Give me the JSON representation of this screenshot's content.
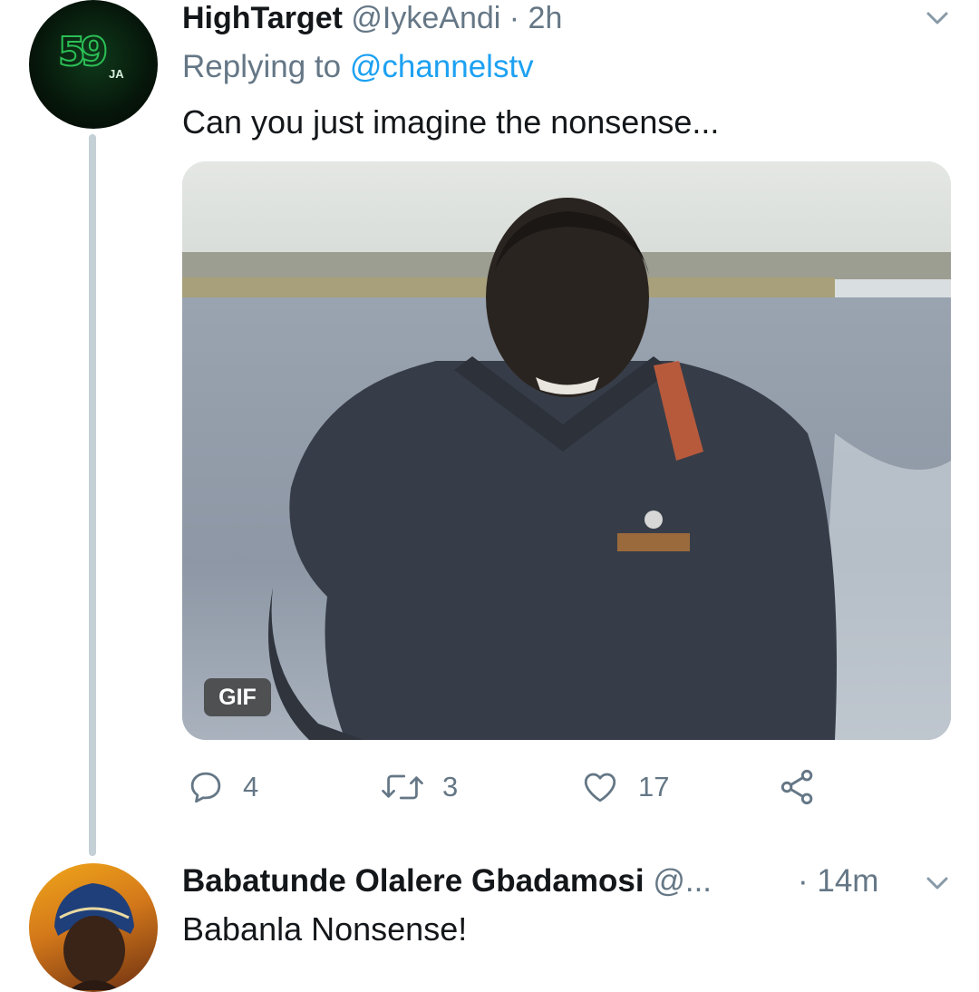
{
  "tweet1": {
    "display_name": "HighTarget",
    "handle": "@IykeAndi",
    "time": "· 2h",
    "replying_prefix": "Replying to ",
    "replying_handle": "@channelstv",
    "text": "Can you just imagine the nonsense...",
    "avatar": {
      "number": "59",
      "suffix": "JA"
    },
    "media_badge": "GIF",
    "stats": {
      "replies": "4",
      "retweets": "3",
      "likes": "17"
    }
  },
  "tweet2": {
    "display_name": "Babatunde Olalere Gbadamosi",
    "handle": "@...",
    "time": "· 14m",
    "text": "Babanla Nonsense!"
  },
  "icons": [
    "chevron-down-icon",
    "reply-icon",
    "retweet-icon",
    "like-icon",
    "share-icon"
  ],
  "colors": {
    "text": "#14171a",
    "muted": "#657786",
    "link": "#1da1f2",
    "thread_line": "#c4cfd6"
  }
}
